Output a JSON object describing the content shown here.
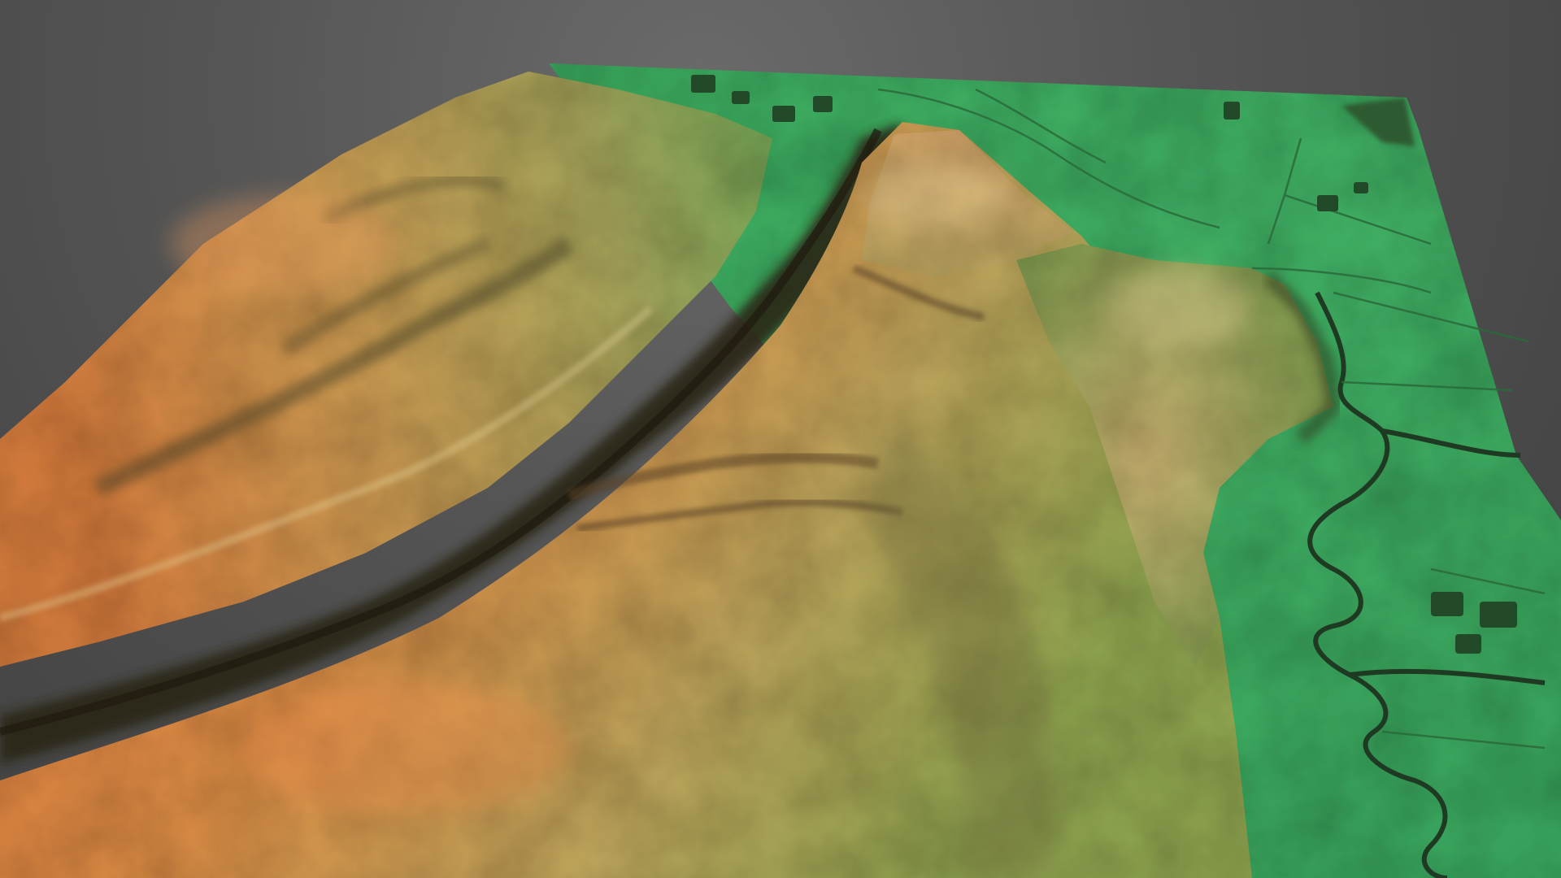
{
  "scene": {
    "background_color": "#4a4a4a",
    "colors": {
      "high_elevation": "#e07a3a",
      "mid_elevation": "#b9a25a",
      "low_elevation": "#3fae63",
      "shadow": "#2a2418",
      "stream": "#1f3a22"
    },
    "features": [
      "hillside-left",
      "central-ridge",
      "stream-valley",
      "lowland-floodplain",
      "meandering-river",
      "field-boundaries",
      "buildings"
    ]
  }
}
